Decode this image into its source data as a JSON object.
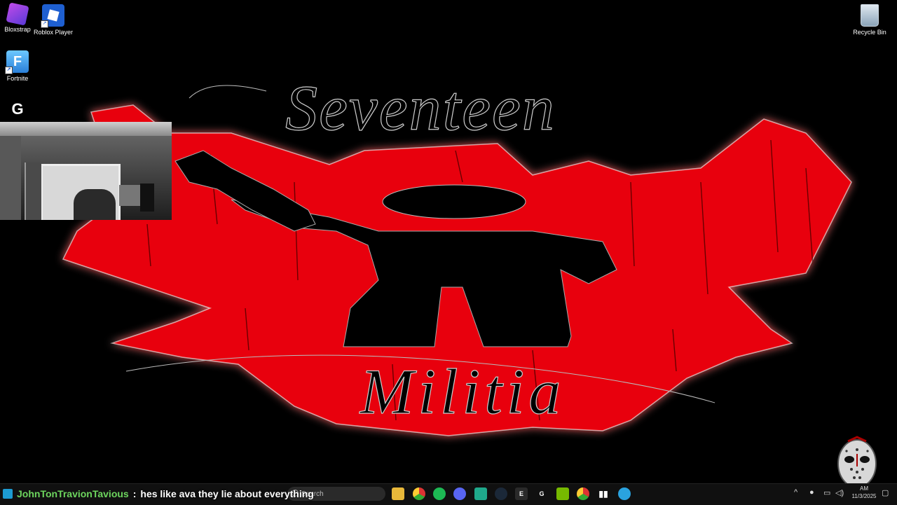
{
  "desktop_icons": [
    {
      "label": "Bloxstrap",
      "icon": "bloxstrap-icon",
      "color": "#7a4dd8"
    },
    {
      "label": "Roblox Player",
      "icon": "roblox-icon",
      "color": "#1e5fd0"
    },
    {
      "label": "Fortnite",
      "icon": "fortnite-icon",
      "color": "#3aa0e8"
    },
    {
      "label": "Logitech G Hub",
      "icon": "logitech-g-icon",
      "color": "#111111"
    },
    {
      "label": "Recycle Bin",
      "icon": "recycle-bin-icon",
      "color": "#9fb4c8"
    }
  ],
  "wallpaper": {
    "top_script": "Seventeen",
    "bottom_script": "Militia",
    "accent_color": "#e8000a"
  },
  "chat": {
    "username": "JohnTonTravionTavious",
    "separator": ":",
    "message": "hes like ava they lie about everything"
  },
  "taskbar": {
    "search_placeholder": "Search",
    "apps": [
      "file-explorer-icon",
      "chrome-icon",
      "spotify-icon",
      "discord-icon",
      "app-icon",
      "steam-icon",
      "epic-games-icon",
      "logitech-g-icon",
      "nvidia-icon",
      "chrome-icon",
      "audio-app-icon",
      "telegram-icon"
    ],
    "clock_time": "AM",
    "clock_date": "11/3/2025"
  }
}
